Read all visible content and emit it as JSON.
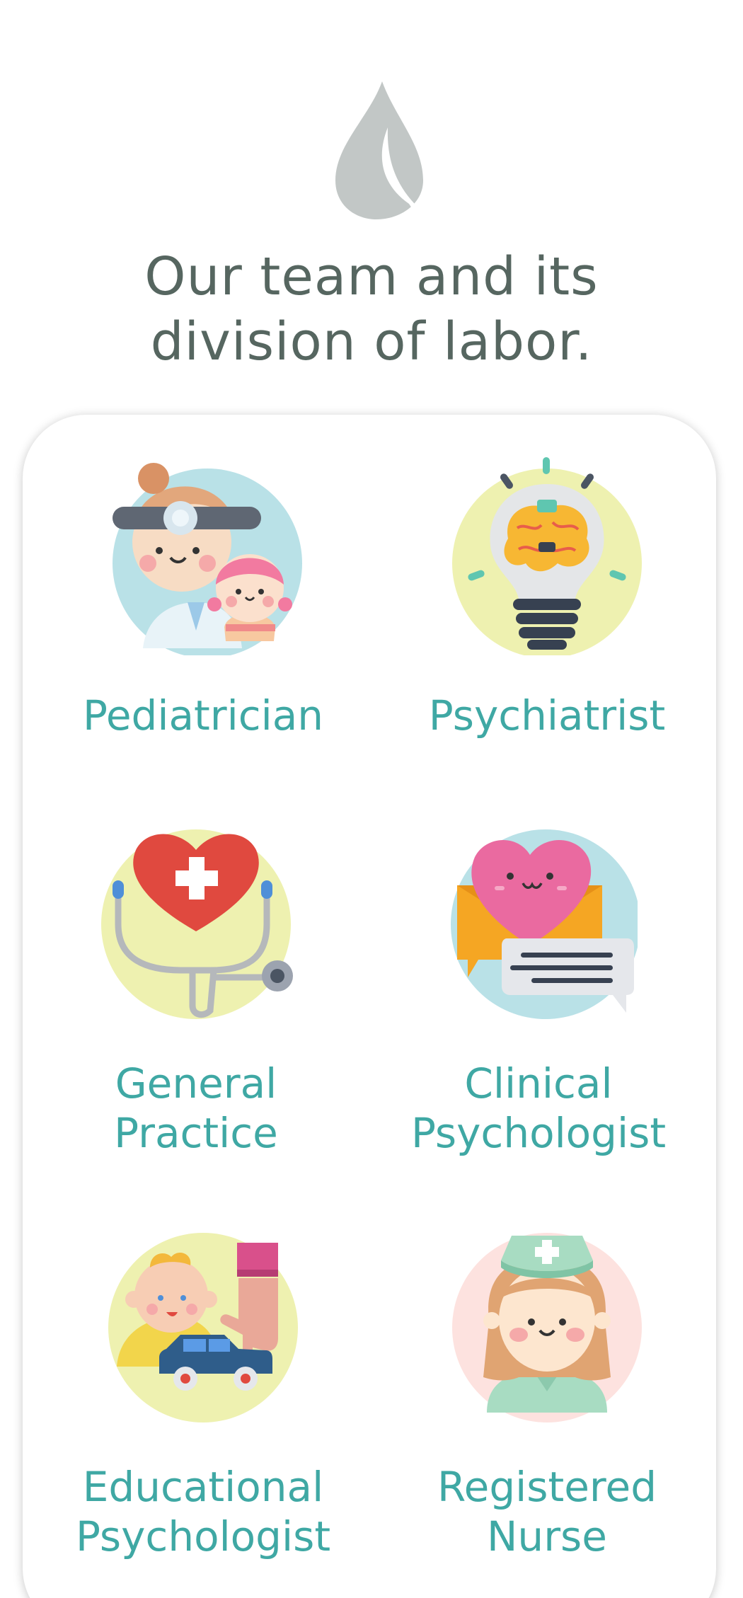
{
  "header": {
    "logo_icon": "leaf-drop-icon",
    "title_line1": "Our team and its",
    "title_line2": "division of labor."
  },
  "team": [
    {
      "icon": "pediatrician-icon",
      "label_line1": "Pediatrician",
      "label_line2": ""
    },
    {
      "icon": "brain-lightbulb-icon",
      "label_line1": "Psychiatrist",
      "label_line2": ""
    },
    {
      "icon": "heart-stethoscope-icon",
      "label_line1": "General",
      "label_line2": "Practice"
    },
    {
      "icon": "heart-message-icon",
      "label_line1": "Clinical",
      "label_line2": "Psychologist"
    },
    {
      "icon": "baby-toy-car-icon",
      "label_line1": "Educational",
      "label_line2": "Psychologist"
    },
    {
      "icon": "nurse-icon",
      "label_line1": "Registered",
      "label_line2": "Nurse"
    }
  ],
  "colors": {
    "headline": "#566660",
    "label": "#3fa8a4",
    "logo": "#c2c7c6"
  }
}
